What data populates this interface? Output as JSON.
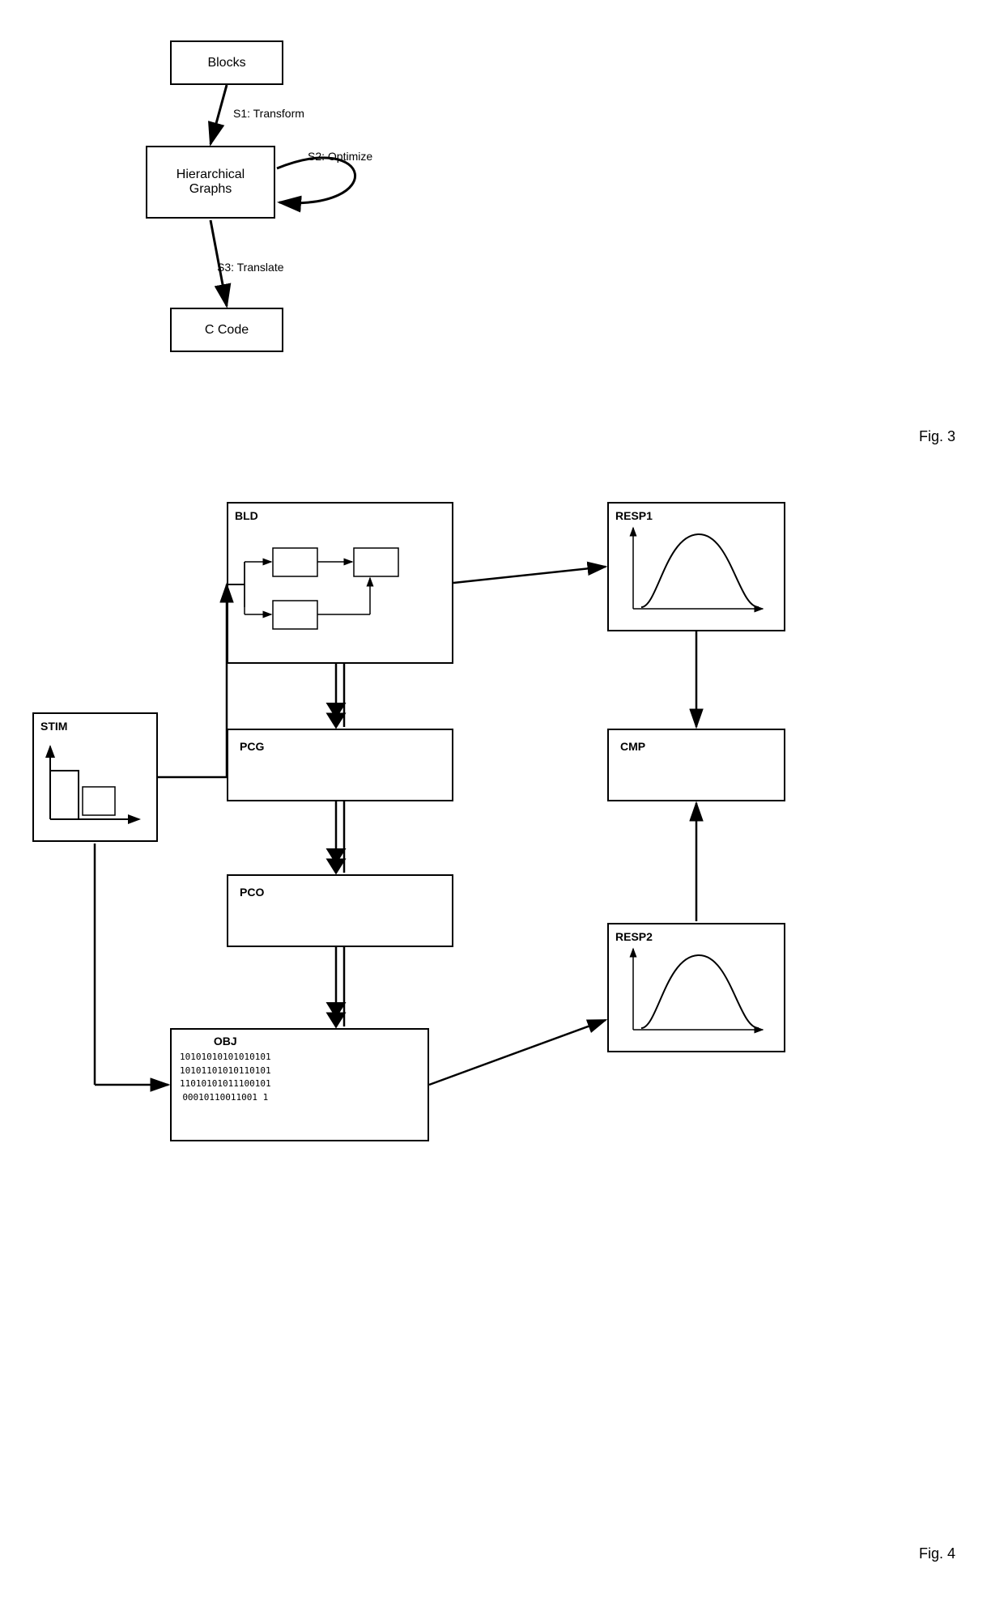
{
  "fig3": {
    "title": "Fig. 3",
    "blocks_label": "Blocks",
    "hg_label": "Hierarchical\nGraphs",
    "ccode_label": "C Code",
    "s1_label": "S1: Transform",
    "s2_label": "S2: Optimize",
    "s3_label": "S3: Translate"
  },
  "fig4": {
    "title": "Fig. 4",
    "stim_label": "STIM",
    "bld_label": "BLD",
    "resp1_label": "RESP1",
    "pcg_label": "PCG",
    "cmp_label": "CMP",
    "pco_label": "PCO",
    "resp2_label": "RESP2",
    "obj_label": "OBJ",
    "obj_data_1": "10101010101010101",
    "obj_data_2": "10101101010110101",
    "obj_data_3": "11010101011100101",
    "obj_data_4": "00010110011001 1"
  }
}
